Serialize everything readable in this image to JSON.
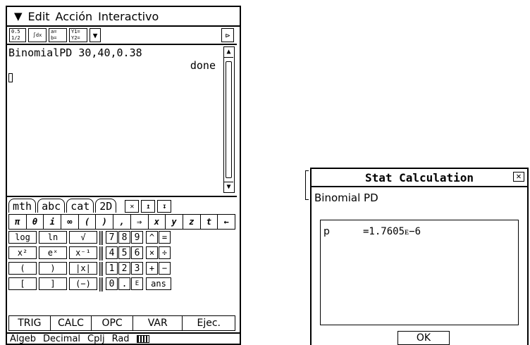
{
  "calculator": {
    "menu": {
      "menu_icon": "chevron-down-icon",
      "items": [
        "Edit",
        "Acción",
        "Interactivo"
      ]
    },
    "toolbar": {
      "buttons": [
        "0.5 1/2",
        "∫dx",
        "a= b=",
        "Y1= Y2="
      ]
    },
    "workarea": {
      "command": "BinomialPD 30,40,0.38",
      "result": "done"
    },
    "tabs": [
      "mth",
      "abc",
      "cat",
      "2D"
    ],
    "symbols": [
      "π",
      "θ",
      "i",
      "∞",
      "(",
      ")",
      ",",
      "⇒",
      "x",
      "y",
      "z",
      "t",
      "←"
    ],
    "function_keys": [
      [
        "log",
        "ln",
        "√"
      ],
      [
        "x²",
        "eˣ",
        "x⁻¹"
      ],
      [
        "(",
        ")",
        "|x|"
      ],
      [
        "[",
        "]",
        "(−)"
      ]
    ],
    "numeric_keys": [
      [
        "7",
        "8",
        "9"
      ],
      [
        "4",
        "5",
        "6"
      ],
      [
        "1",
        "2",
        "3"
      ],
      [
        "0",
        ".",
        "E"
      ]
    ],
    "operator_keys": [
      [
        "^",
        "="
      ],
      [
        "×",
        "÷"
      ],
      [
        "+",
        "−"
      ],
      [
        "ans"
      ]
    ],
    "softkeys": [
      "TRIG",
      "CALC",
      "OPC",
      "VAR",
      "Ejec."
    ],
    "status": {
      "mode1": "Algeb",
      "mode2": "Decimal",
      "mode3": "Cplj",
      "mode4": "Rad"
    }
  },
  "dialog": {
    "title": "Stat Calculation",
    "subtitle": "Binomial PD",
    "result_label": "p",
    "result_value": "=1.7605ᴇ−6",
    "ok_label": "OK"
  }
}
